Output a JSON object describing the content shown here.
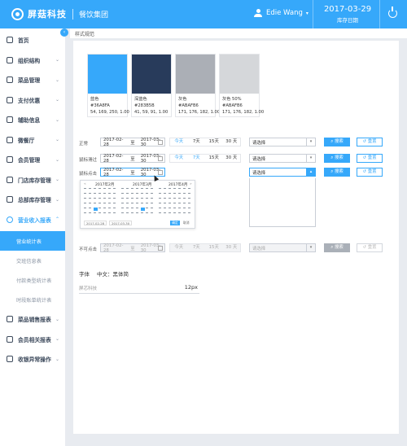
{
  "header": {
    "brand": "屏菇科技",
    "group": "餐饮集团",
    "user_name": "Edie Wang",
    "date": "2017-03-29",
    "date_label": "库存日期"
  },
  "sidebar": {
    "items": [
      {
        "label": "首页"
      },
      {
        "label": "组织结构"
      },
      {
        "label": "菜品管理"
      },
      {
        "label": "支付优惠"
      },
      {
        "label": "辅助信息"
      },
      {
        "label": "微餐厅"
      },
      {
        "label": "会员管理"
      },
      {
        "label": "门店库存管理"
      },
      {
        "label": "总部库存管理"
      },
      {
        "label": "营业收入报表"
      },
      {
        "label": "菜品销售报表"
      },
      {
        "label": "会员相关报表"
      },
      {
        "label": "收银异常操作"
      }
    ],
    "subitems": [
      {
        "label": "营业统计表"
      },
      {
        "label": "交班信息表"
      },
      {
        "label": "付款类型统计表"
      },
      {
        "label": "时段账单统计表"
      }
    ]
  },
  "page": {
    "breadcrumb": "样式规范"
  },
  "swatches": [
    {
      "name": "蓝色",
      "hex": "#36A8FA",
      "rgb": "54, 169, 250, 1.00",
      "color": "#36a8fa"
    },
    {
      "name": "深蓝色",
      "hex": "#283B5B",
      "rgb": "41, 59, 91, 1.00",
      "color": "#283b5b"
    },
    {
      "name": "灰色",
      "hex": "#ABAFB6",
      "rgb": "171, 176, 182, 1.00",
      "color": "#abafb6"
    },
    {
      "name": "灰色  50%",
      "hex": "#ABAFB6",
      "rgb": "171, 176, 182, 1.00",
      "color": "#d5d7da"
    }
  ],
  "form_rows": [
    {
      "label": "正常",
      "start": "2017-02-28",
      "to": "至",
      "end": "2017-03-30",
      "quick": [
        "今天",
        "7天",
        "15天",
        "30 天"
      ],
      "select": "请选择",
      "search": "搜索",
      "reset": "重置"
    },
    {
      "label": "鼠标滑过",
      "start": "2017-02-28",
      "to": "至",
      "end": "2017-03-30",
      "quick": [
        "今天",
        "7天",
        "15天",
        "30 天"
      ],
      "select": "请选择",
      "search": "搜索",
      "reset": "重置"
    },
    {
      "label": "鼠标点击",
      "start": "2017-02-28",
      "to": "至",
      "end": "2017-03-30",
      "select": "请选择",
      "search": "搜索",
      "reset": "重置"
    },
    {
      "label": "不可点击",
      "start": "2017-02-28",
      "to": "至",
      "end": "2017-03-30",
      "quick": [
        "今天",
        "7天",
        "15天",
        "30 天"
      ],
      "select": "请选择",
      "search": "搜索",
      "reset": "重置"
    }
  ],
  "calendar": {
    "months": [
      "2017年2月",
      "2017年3月",
      "2017年4月"
    ],
    "foot": [
      "2017-02-28",
      "2017-03-30"
    ],
    "ok": "确定",
    "cancel": "取消"
  },
  "font": {
    "label": "字体",
    "value": "中文：黑体简",
    "sample_text": "屏芯科技",
    "sample_size": "12px"
  },
  "colors": {
    "accent": "#36a8fa",
    "nav_text": "#3d4a5c",
    "background": "#e8ebf0"
  }
}
